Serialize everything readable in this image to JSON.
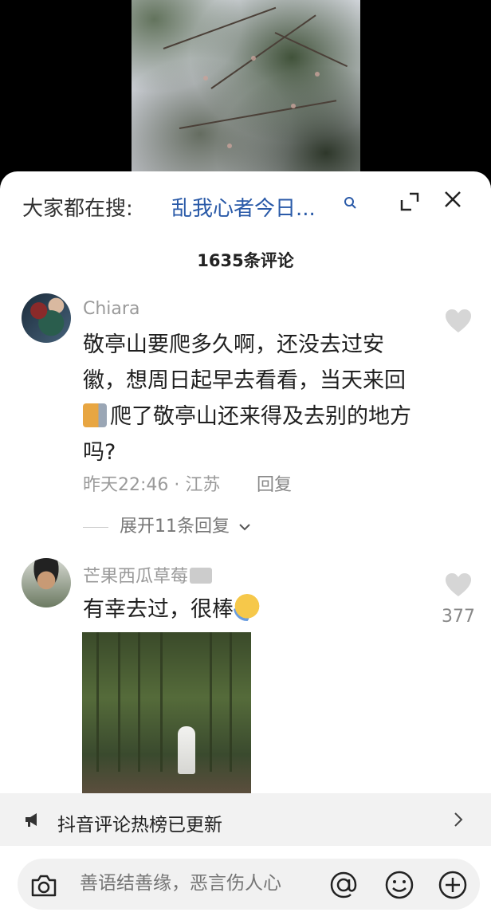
{
  "search": {
    "prefix": "大家都在搜:",
    "term": "乱我心者今日..."
  },
  "comments_header": {
    "count_label": "1635条评论"
  },
  "comments": [
    {
      "username": "Chiara",
      "text_part1": "敬亭山要爬多久啊，还没去过安徽，想周日起早去看看，当天来回",
      "text_part2": "爬了敬亭山还来得及去别的地方吗?",
      "time_location": "昨天22:46 · 江苏",
      "reply_label": "回复",
      "expand_label": "展开11条回复"
    },
    {
      "username": "芒果西瓜草莓",
      "text": "有幸去过，很棒",
      "like_count": "377"
    }
  ],
  "hot_banner": {
    "text": "抖音评论热榜已更新"
  },
  "input": {
    "placeholder": "善语结善缘，恶言伤人心"
  },
  "colors": {
    "search_term": "#2a5aa8",
    "muted": "#9a9a9a",
    "text": "#1f1f1f"
  }
}
